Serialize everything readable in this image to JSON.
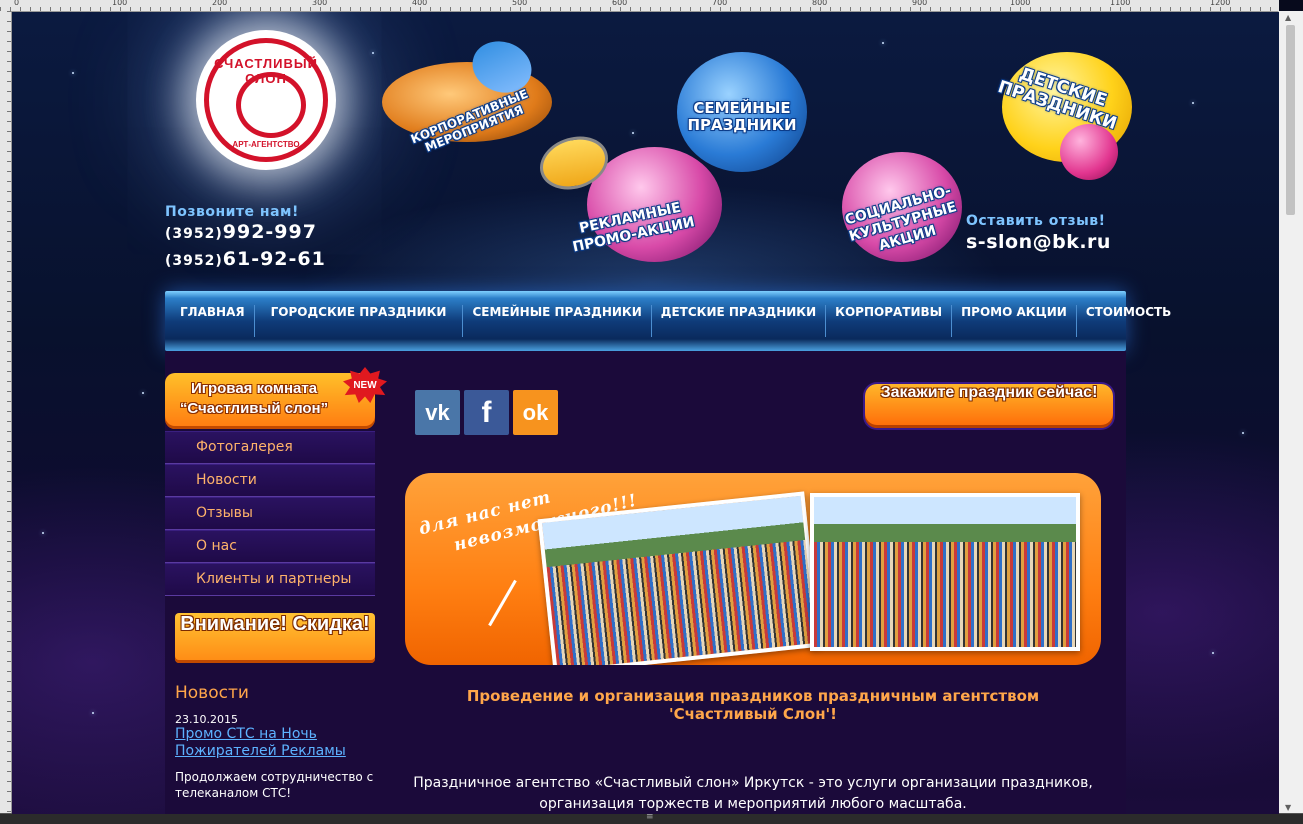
{
  "ruler": {
    "marks": [
      "0",
      "100",
      "200",
      "300",
      "400",
      "500",
      "600",
      "700",
      "800",
      "900",
      "1000",
      "1100",
      "1200"
    ]
  },
  "header": {
    "logo": {
      "name": "СЧАСТЛИВЫЙ СЛОН",
      "sub": "АРТ-АГЕНТСТВО"
    },
    "call_label": "Позвоните нам!",
    "phones": [
      {
        "code": "(3952)",
        "number": "992-997"
      },
      {
        "code": "(3952)",
        "number": "61-92-61"
      }
    ],
    "review_label": "Оставить отзыв!",
    "email": "s-slon@bk.ru",
    "bubbles": [
      {
        "text": "КОРПОРАТИВНЫЕ МЕРОПРИЯТИЯ"
      },
      {
        "text": "СЕМЕЙНЫЕ ПРАЗДНИКИ"
      },
      {
        "text": "ДЕТСКИЕ ПРАЗДНИКИ"
      },
      {
        "text": "РЕКЛАМНЫЕ ПРОМО-АКЦИИ"
      },
      {
        "text": "СОЦИАЛЬНО-КУЛЬТУРНЫЕ АКЦИИ"
      }
    ]
  },
  "nav": {
    "items": [
      "ГЛАВНАЯ",
      "ГОРОДСКИЕ ПРАЗДНИКИ",
      "СЕМЕЙНЫЕ ПРАЗДНИКИ",
      "ДЕТСКИЕ ПРАЗДНИКИ",
      "КОРПОРАТИВЫ",
      "ПРОМО АКЦИИ",
      "СТОИМОСТЬ"
    ]
  },
  "sidebar": {
    "promo": {
      "line1": "Игровая комната",
      "line2": "“Счастливый слон”",
      "badge": "NEW"
    },
    "menu": [
      "Фотогалерея",
      "Новости",
      "Отзывы",
      "О нас",
      "Клиенты и партнеры"
    ],
    "sale": "Внимание! Скидка!",
    "news": {
      "heading": "Новости",
      "date": "23.10.2015",
      "link": "Промо СТС на Ночь Пожирателей Рекламы",
      "text": "Продолжаем сотрудничество с телеканалом СТС!"
    }
  },
  "social": [
    {
      "icon": "vk-icon",
      "label": "vk",
      "color": "#4a76a8"
    },
    {
      "icon": "facebook-icon",
      "label": "f",
      "color": "#3b5998"
    },
    {
      "icon": "odnoklassniki-icon",
      "label": "ok",
      "color": "#f7931e"
    }
  ],
  "order_button": "Закажите праздник сейчас!",
  "banner": {
    "slogan_1": "для нас нет",
    "slogan_2": "невозможного!!!"
  },
  "main": {
    "title_1": "Проведение и организация праздников праздничным агентством",
    "title_2": "'Счастливый Слон'!",
    "desc_1": "Праздничное агентство «Счастливый слон» Иркутск - это услуги организации праздников,",
    "desc_2": "организация торжеств и мероприятий любого масштаба."
  },
  "colors": {
    "accent_orange": "#ff7f12",
    "link_blue": "#5db2ff",
    "label_blue": "#7ec4ff",
    "heading_orange": "#ffa64a"
  }
}
